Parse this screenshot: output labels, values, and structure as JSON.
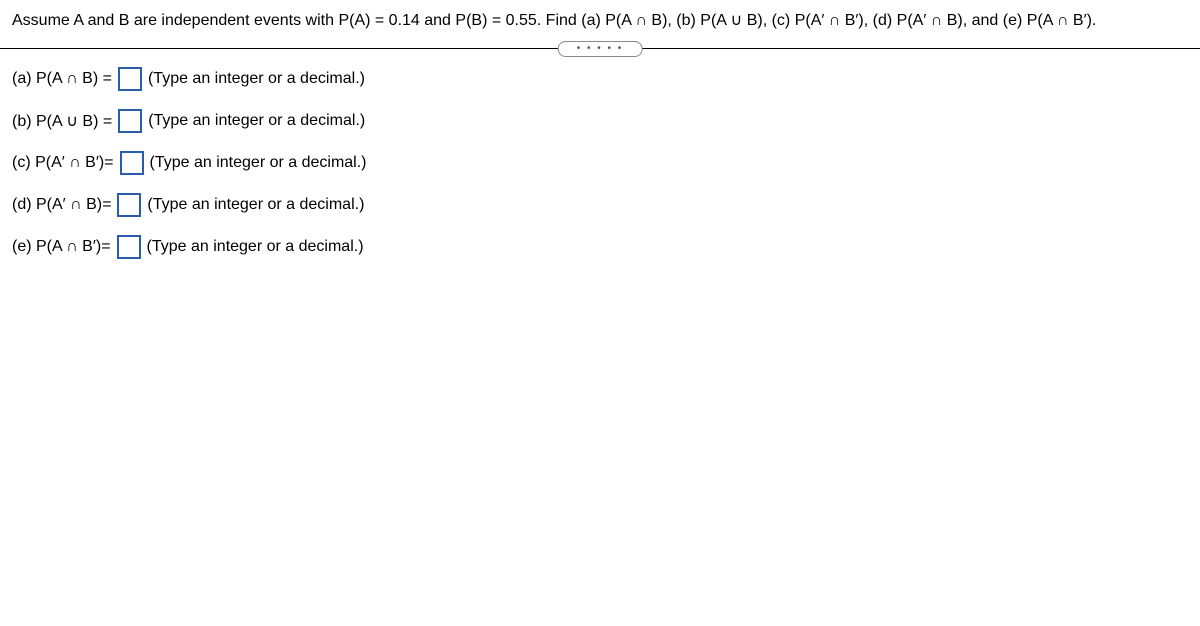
{
  "question": {
    "prefix": "Assume A and B are independent events with P(A) = 0.14 and P(B) = 0.55. Find (a) P(A ∩ B), (b) P(A ∪ B), (c) P",
    "part_c": "(A′ ∩ B′)",
    "mid1": ", (d) P",
    "part_d": "(A′ ∩ B)",
    "mid2": ", and (e) P",
    "part_e": "(A ∩ B′)",
    "suffix": "."
  },
  "ellipsis": "• • • • •",
  "parts": {
    "a": {
      "label": "(a) P(A ∩ B) =",
      "hint": "(Type an integer or a decimal.)"
    },
    "b": {
      "label": "(b) P(A ∪ B) =",
      "hint": "(Type an integer or a decimal.)"
    },
    "c": {
      "prefix": "(c) P",
      "expr": "(A′ ∩ B′)",
      "eq": " = ",
      "hint": "(Type an integer or a decimal.)"
    },
    "d": {
      "prefix": "(d) P",
      "expr": "(A′ ∩ B)",
      "eq": " = ",
      "hint": "(Type an integer or a decimal.)"
    },
    "e": {
      "prefix": "(e) P",
      "expr": "(A ∩ B′)",
      "eq": " = ",
      "hint": "(Type an integer or a decimal.)"
    }
  }
}
